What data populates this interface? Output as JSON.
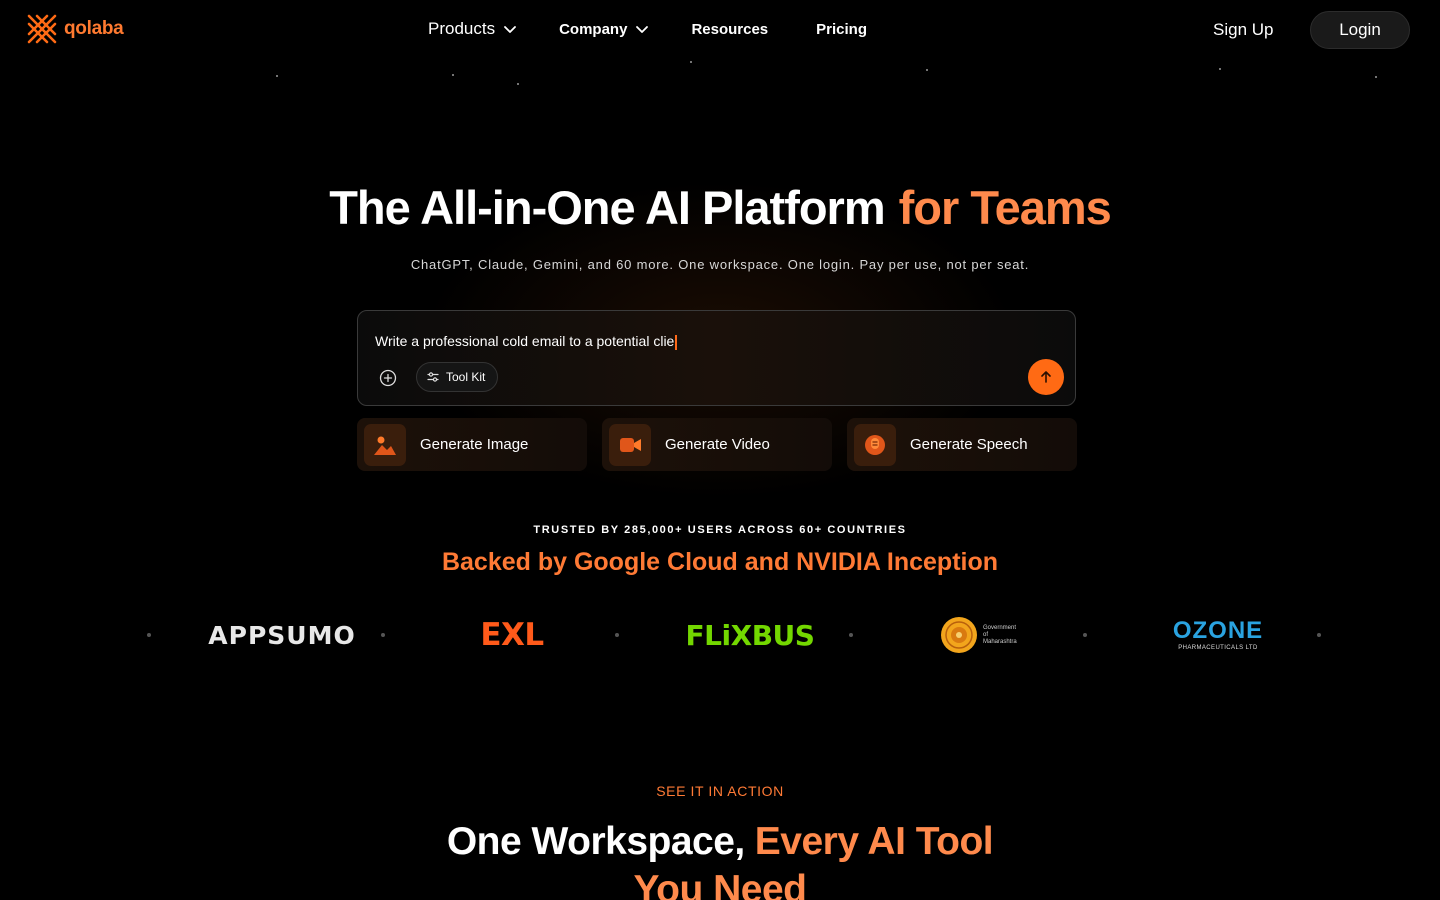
{
  "brand": {
    "name": "qolaba",
    "icon": "qolaba-logo-icon",
    "accent_color": "#ff6a14"
  },
  "nav": {
    "items": [
      {
        "label": "Products",
        "has_dropdown": true
      },
      {
        "label": "Company",
        "has_dropdown": true
      },
      {
        "label": "Resources",
        "has_dropdown": false
      },
      {
        "label": "Pricing",
        "has_dropdown": false
      }
    ],
    "signup_label": "Sign Up",
    "login_label": "Login"
  },
  "hero": {
    "title_main": "The All-in-One AI Platform",
    "title_accent": "for Teams",
    "subtitle": "ChatGPT, Claude, Gemini, and 60 more. One workspace. One login. Pay per use, not per seat."
  },
  "prompt": {
    "value": "Write a professional cold email to a potential clie",
    "add_icon": "plus-circle-icon",
    "toolkit_label": "Tool Kit",
    "toolkit_icon": "sliders-icon",
    "send_icon": "arrow-up-icon"
  },
  "actions": [
    {
      "label": "Generate Image",
      "icon": "image-icon"
    },
    {
      "label": "Generate Video",
      "icon": "video-icon"
    },
    {
      "label": "Generate Speech",
      "icon": "speech-icon"
    }
  ],
  "trust": {
    "users_line": "TRUSTED BY 285,000+ USERS ACROSS 60+ COUNTRIES",
    "backed_line": "Backed by Google Cloud and NVIDIA Inception",
    "logos": {
      "appsumo": "APPSUMO",
      "exl": "EXL",
      "flixbus": "FLiXBUS",
      "gov": "Government of Maharashtra",
      "ozone_main": "OZONE",
      "ozone_sub": "PHARMACEUTICALS LTD"
    }
  },
  "section": {
    "eyebrow": "SEE IT IN ACTION",
    "title_main": "One Workspace,",
    "title_accent": "Every AI Tool",
    "title_line2": "You Need"
  }
}
